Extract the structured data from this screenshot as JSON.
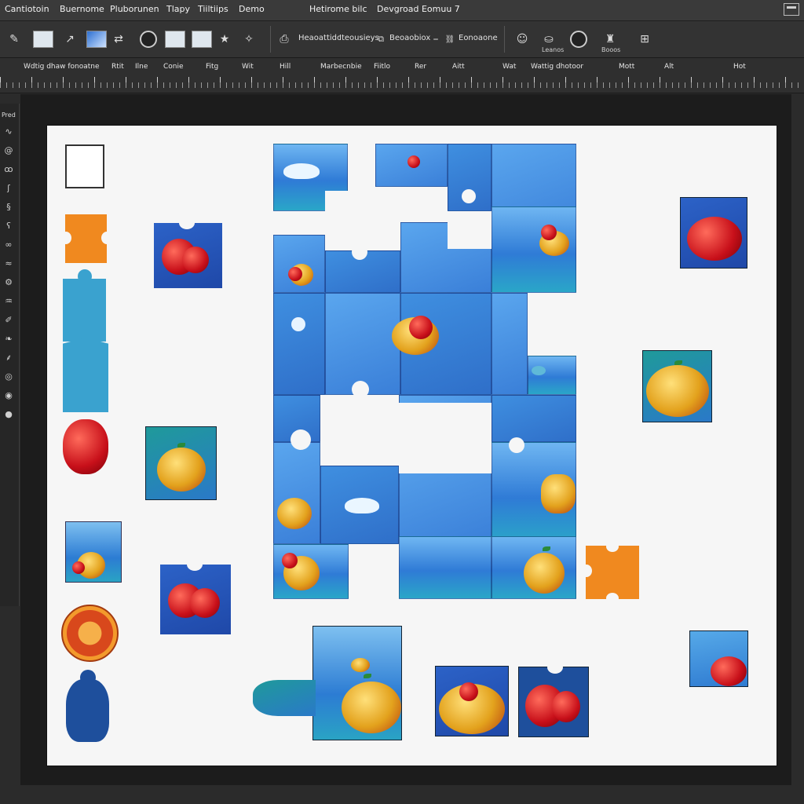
{
  "menubar": {
    "items": [
      "Cantiotoin",
      "Buernome",
      "Pluborunen",
      "Tlapy",
      "Tiiltiips",
      "Demo"
    ],
    "title_left": "Hetirome bilc",
    "title_right": "Devgroad Eomuu 7"
  },
  "toolbar": {
    "labels": [
      "Heaoattidc",
      "Iteousieys",
      "Beoaobiox",
      "Eonoaone"
    ],
    "sublabels": [
      "Leanos",
      "Booos"
    ]
  },
  "ruler": {
    "labels": [
      "Wdtig dhaw fonoatne",
      "Rtit",
      "Ilne",
      "Conie",
      "Fitg",
      "Wit",
      "Hill",
      "Marbecnbie",
      "Fiitlo",
      "Rer",
      "Aitt",
      "Wat",
      "Wattig dhotoor",
      "Mott",
      "Alt",
      "Hot"
    ]
  },
  "left_panel": {
    "label": "Pred",
    "icons": [
      "scribble-icon",
      "spiral-icon",
      "knot-icon",
      "curl-icon",
      "swirl-icon",
      "hook-icon",
      "loop-icon",
      "wave-icon",
      "gear-icon",
      "twist-icon",
      "brush-icon",
      "leaf-icon",
      "feather-icon",
      "ring-icon",
      "circle-icon",
      "blob-icon"
    ]
  },
  "colors": {
    "canvas": "#f6f6f6",
    "frame": "#1c1c1c",
    "puzzle_blue": "#3f8fe0",
    "orange": "#f0891f",
    "teal": "#3aa2cf"
  }
}
